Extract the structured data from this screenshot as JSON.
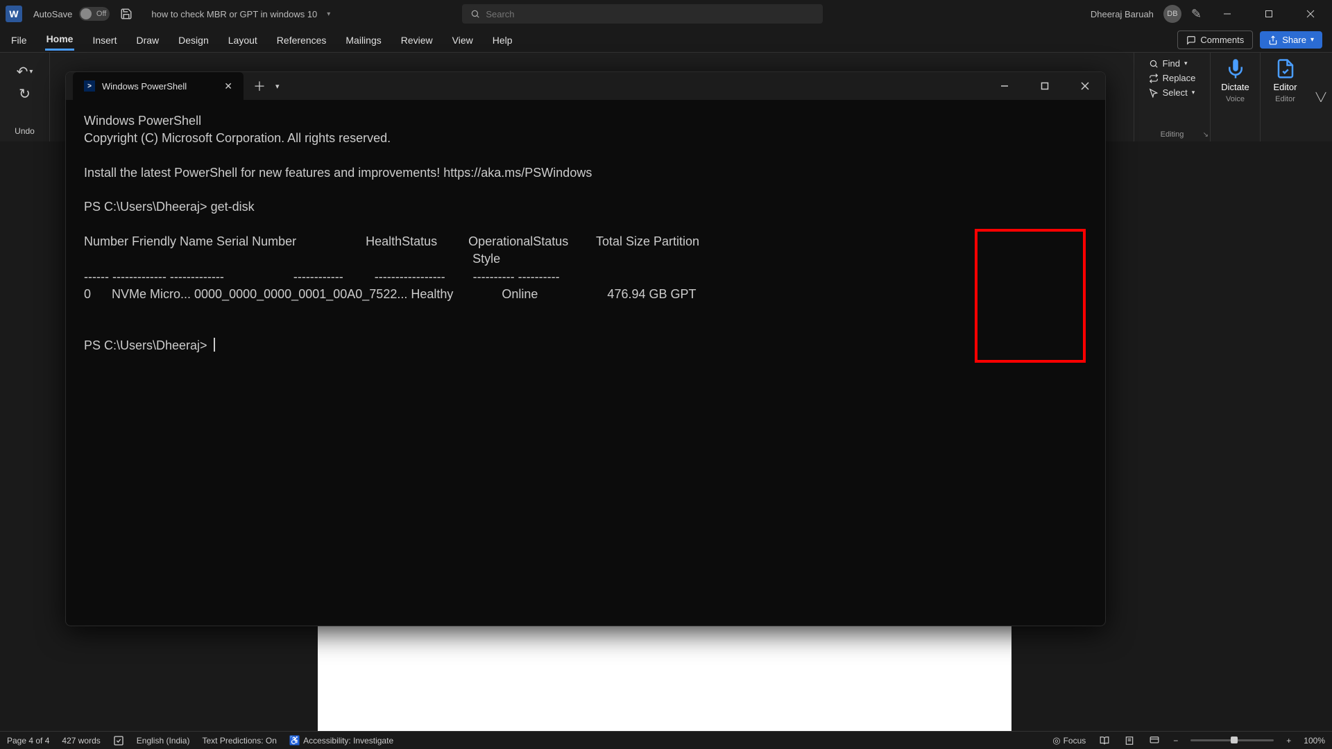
{
  "titlebar": {
    "autosave_label": "AutoSave",
    "autosave_state": "Off",
    "doc_title": "how to check MBR or GPT in windows 10",
    "search_placeholder": "Search",
    "username": "Dheeraj Baruah",
    "initials": "DB"
  },
  "ribbon_tabs": [
    "File",
    "Home",
    "Insert",
    "Draw",
    "Design",
    "Layout",
    "References",
    "Mailings",
    "Review",
    "View",
    "Help"
  ],
  "active_tab": "Home",
  "ribbon_right": {
    "comments": "Comments",
    "share": "Share"
  },
  "undo_group": {
    "label": "Undo"
  },
  "editing_group": {
    "find": "Find",
    "replace": "Replace",
    "select": "Select",
    "label": "Editing"
  },
  "voice_group": {
    "dictate": "Dictate",
    "label": "Voice"
  },
  "editor_group": {
    "editor": "Editor",
    "label": "Editor"
  },
  "powershell": {
    "tab_title": "Windows PowerShell",
    "lines": {
      "l1": "Windows PowerShell",
      "l2": "Copyright (C) Microsoft Corporation. All rights reserved.",
      "l3": "Install the latest PowerShell for new features and improvements! https://aka.ms/PSWindows",
      "prompt1": "PS C:\\Users\\Dheeraj> get-disk",
      "hdr1": "Number Friendly Name Serial Number                    HealthStatus         OperationalStatus        Total Size Partition",
      "hdr2": "                                                                                                                Style",
      "sep": "------ ------------- -------------                    ------------         -----------------        ---------- ----------",
      "row": "0      NVMe Micro... 0000_0000_0000_0001_00A0_7522... Healthy              Online                    476.94 GB GPT",
      "prompt2": "PS C:\\Users\\Dheeraj> "
    }
  },
  "chart_data": {
    "type": "table",
    "title": "get-disk output",
    "columns": [
      "Number",
      "Friendly Name",
      "Serial Number",
      "HealthStatus",
      "OperationalStatus",
      "Total Size",
      "Partition Style"
    ],
    "rows": [
      {
        "Number": 0,
        "Friendly Name": "NVMe Micro...",
        "Serial Number": "0000_0000_0000_0001_00A0_7522...",
        "HealthStatus": "Healthy",
        "OperationalStatus": "Online",
        "Total Size": "476.94 GB",
        "Partition Style": "GPT"
      }
    ]
  },
  "statusbar": {
    "page": "Page 4 of 4",
    "words": "427 words",
    "language": "English (India)",
    "predictions": "Text Predictions: On",
    "accessibility": "Accessibility: Investigate",
    "focus": "Focus",
    "zoom": "100%"
  }
}
